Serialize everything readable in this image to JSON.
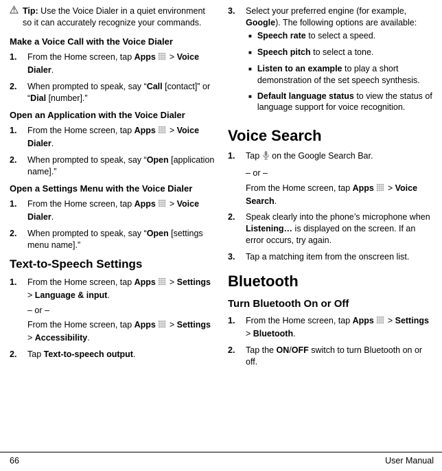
{
  "col1": {
    "tip_label": "Tip:",
    "tip_text": " Use the Voice Dialer in a quiet environment so it can accurately recognize your commands.",
    "make_call_heading": "Make a Voice Call with the Voice Dialer",
    "mc1_a": "From the Home screen, tap ",
    "mc1_apps": "Apps",
    "mc1_gt": " > ",
    "mc1_vd": "Voice Dialer",
    "mc1_dot": ".",
    "mc2_a": "When prompted to speak, say “",
    "mc2_call": "Call",
    "mc2_mid": " [contact]” or “",
    "mc2_dial": "Dial",
    "mc2_end": " [number].”",
    "open_app_heading": "Open an Application with the Voice Dialer",
    "oa1_a": "From the Home screen, tap ",
    "oa1_apps": "Apps",
    "oa1_gt": " > ",
    "oa1_vd": "Voice Dialer",
    "oa1_dot": ".",
    "oa2_a": "When prompted to speak, say “",
    "oa2_open": "Open",
    "oa2_end": " [application name].”",
    "open_set_heading": "Open a Settings Menu with the Voice Dialer",
    "os1_a": "From the Home screen, tap ",
    "os1_apps": "Apps",
    "os1_gt": " > ",
    "os1_vd": "Voice Dialer",
    "os1_dot": ".",
    "os2_a": "When prompted to speak, say “",
    "os2_open": "Open",
    "os2_end": " [settings menu name].”",
    "tts_heading": "Text-to-Speech Settings",
    "tts1_a": "From the Home screen, tap ",
    "tts1_apps": "Apps",
    "tts1_gt1": " > ",
    "tts1_set": "Settings",
    "tts1_gt2": " > ",
    "tts1_lang": "Language & input",
    "tts1_dot": ".",
    "tts_or": "– or –",
    "tts1b_a": "From the Home screen, tap ",
    "tts1b_apps": "Apps",
    "tts1b_gt1": " > ",
    "tts1b_set": "Settings",
    "tts1b_gt2": " > ",
    "tts1b_acc": "Accessibility",
    "tts1b_dot": ".",
    "tts2_a": "Tap ",
    "tts2_b": "Text-to-speech output",
    "tts2_dot": "."
  },
  "col2": {
    "s3_a": "Select your preferred engine (for example, ",
    "s3_b": "Google",
    "s3_c": "). The following options are available:",
    "b1_a": "Speech rate",
    "b1_b": " to select a speed.",
    "b2_a": "Speech pitch",
    "b2_b": " to select a tone.",
    "b3_a": "Listen to an example",
    "b3_b": " to play a short demonstration of the set speech synthesis.",
    "b4_a": "Default language status",
    "b4_b": " to view the status of language support for voice recognition.",
    "vs_heading": "Voice Search",
    "vs1_a": "Tap ",
    "vs1_b": " on the Google Search Bar.",
    "vs_or": "– or –",
    "vs1c_a": "From the Home screen, tap ",
    "vs1c_apps": "Apps",
    "vs1c_gt": " > ",
    "vs1c_vs": "Voice Search",
    "vs1c_dot": ".",
    "vs2_a": "Speak clearly into the phone’s microphone when ",
    "vs2_b": "Listening…",
    "vs2_c": " is displayed on the screen. If an error occurs, try again.",
    "vs3": "Tap a matching item from the onscreen list.",
    "bt_heading": "Bluetooth",
    "bt_sub": "Turn Bluetooth On or Off",
    "bt1_a": "From the Home screen, tap ",
    "bt1_apps": "Apps",
    "bt1_gt1": " > ",
    "bt1_set": "Settings",
    "bt1_gt2": " > ",
    "bt1_bt": "Bluetooth",
    "bt1_dot": ".",
    "bt2_a": "Tap the ",
    "bt2_b": "ON",
    "bt2_slash": "/",
    "bt2_c": "OFF",
    "bt2_d": " switch to turn Bluetooth on or off."
  },
  "footer": {
    "page": "66",
    "label": "User Manual"
  },
  "nums": {
    "n1": "1.",
    "n2": "2.",
    "n3": "3."
  }
}
